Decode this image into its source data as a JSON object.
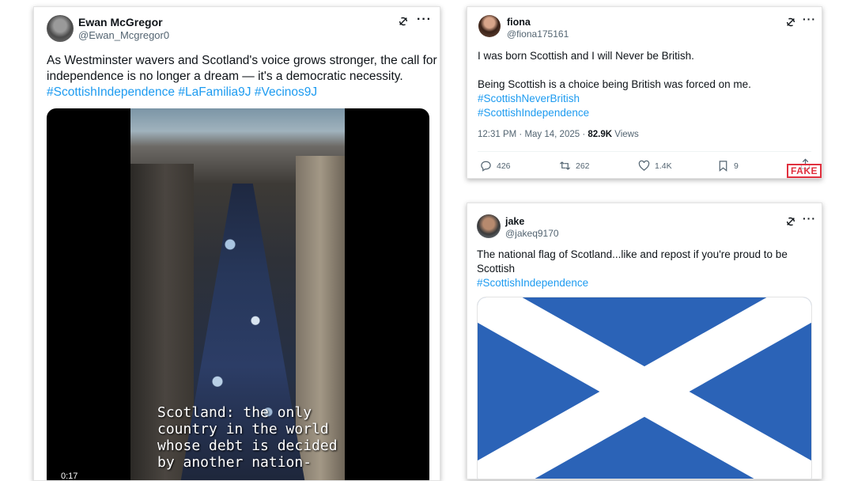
{
  "posts": [
    {
      "name": "Ewan McGregor",
      "handle": "@Ewan_Mcgregor0",
      "text_lines": [
        "As Westminster wavers and Scotland's voice grows stronger, the call for",
        "independence is no longer a dream — it's a democratic necessity."
      ],
      "hashtags": [
        "#ScottishIndependence",
        "#LaFamilia9J",
        "#Vecinos9J"
      ],
      "video": {
        "subtitle_lines": [
          "Scotland: the only",
          "country in the world",
          "whose debt is decided",
          "by another nation-"
        ],
        "time": "0:17"
      }
    },
    {
      "name": "fiona",
      "handle": "@fiona175161",
      "text_lines": [
        "I was born Scottish and I will Never be British.",
        "",
        "Being Scottish is a choice being British was forced on me."
      ],
      "hashtags": [
        "#ScottishNeverBritish",
        "#ScottishIndependence"
      ],
      "meta_time": "12:31 PM · May 14, 2025 · ",
      "views_count": "82.9K",
      "views_label": " Views",
      "actions": {
        "replies": "426",
        "reposts": "262",
        "likes": "1.4K",
        "bookmarks": "9"
      },
      "stamp": "FAKE"
    },
    {
      "name": "jake",
      "handle": "@jakeq9170",
      "text_lines": [
        "The national flag of Scotland...like and repost if you're proud to be",
        "Scottish"
      ],
      "hashtags": [
        "#ScottishIndependence"
      ],
      "flag": {
        "field_color": "#2b63b7",
        "saltire_color": "#ffffff"
      }
    }
  ]
}
